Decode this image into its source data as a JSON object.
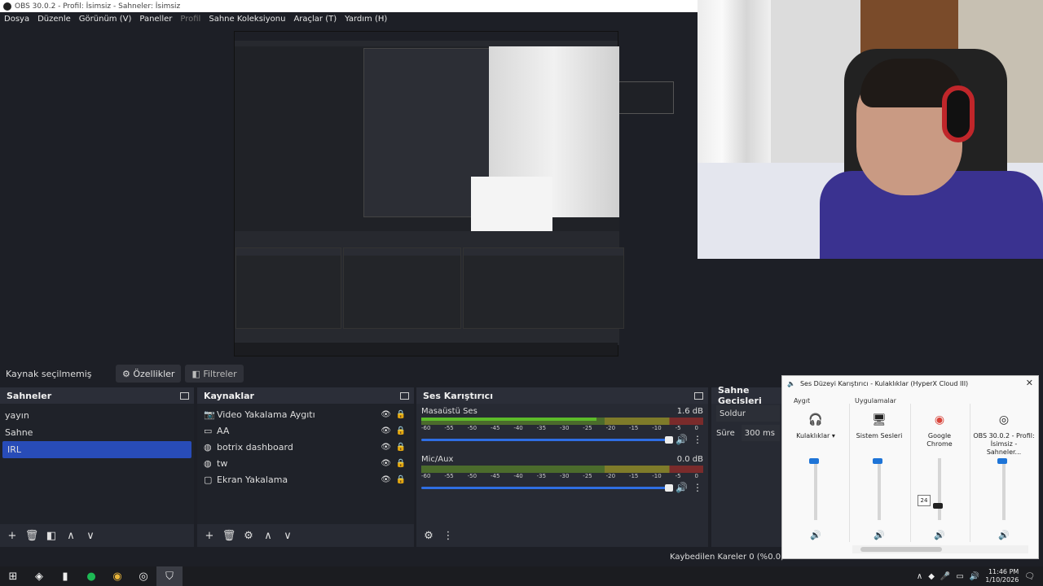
{
  "window": {
    "title": "OBS 30.0.2 - Profil: İsimsiz - Sahneler: İsimsiz"
  },
  "menu": [
    "Dosya",
    "Düzenle",
    "Görünüm (V)",
    "Paneller",
    "Profil",
    "Sahne Koleksiyonu",
    "Araçlar (T)",
    "Yardım (H)"
  ],
  "source_toolbar": {
    "label": "Kaynak seçilmemiş",
    "properties": "Özellikler",
    "filters": "Filtreler"
  },
  "scenes": {
    "title": "Sahneler",
    "items": [
      "yayın",
      "Sahne",
      "IRL"
    ],
    "selected": "IRL"
  },
  "sources": {
    "title": "Kaynaklar",
    "items": [
      {
        "name": "Video Yakalama Aygıtı",
        "icon": "camera-icon"
      },
      {
        "name": "AA",
        "icon": "window-icon"
      },
      {
        "name": "botrix dashboard",
        "icon": "globe-icon"
      },
      {
        "name": "tw",
        "icon": "globe-icon"
      },
      {
        "name": "Ekran Yakalama",
        "icon": "monitor-icon"
      }
    ]
  },
  "audio_mixer": {
    "title": "Ses Karıştırıcı",
    "tracks": [
      {
        "name": "Masaüstü Ses",
        "db": "1.6 dB",
        "level": 0.62
      },
      {
        "name": "Mic/Aux",
        "db": "0.0 dB",
        "level": 0.0
      }
    ],
    "ticks": [
      "-60",
      "-55",
      "-50",
      "-45",
      "-40",
      "-35",
      "-30",
      "-25",
      "-20",
      "-15",
      "-10",
      "-5",
      "0"
    ]
  },
  "transitions": {
    "title": "Sahne Geçişleri",
    "type": "Soldur",
    "duration_label": "Süre",
    "duration": "300 ms"
  },
  "status": {
    "dropped": "Kaybedilen Kareler 0 (%0.0)"
  },
  "volume_mixer": {
    "title": "Ses Düzeyi Karıştırıcı - Kulaklıklar (HyperX Cloud III)",
    "device_label": "Aygıt",
    "apps_label": "Uygulamalar",
    "columns": [
      {
        "name": "Kulaklıklar",
        "icon": "headphones-icon",
        "level": 1.0
      },
      {
        "name": "Sistem Sesleri",
        "icon": "system-sounds-icon",
        "level": 1.0
      },
      {
        "name": "Google Chrome",
        "icon": "chrome-icon",
        "level": 0.24
      },
      {
        "name": "OBS 30.0.2 - Profil: İsimsiz - Sahneler...",
        "icon": "obs-icon",
        "level": 1.0
      }
    ],
    "tooltip": "24"
  },
  "taskbar": {
    "time": "11:46 PM",
    "date": "1/10/2026"
  },
  "colors": {
    "accent": "#284cb8",
    "slider": "#2f6ee3",
    "mixer_thumb": "#1e74d7"
  }
}
